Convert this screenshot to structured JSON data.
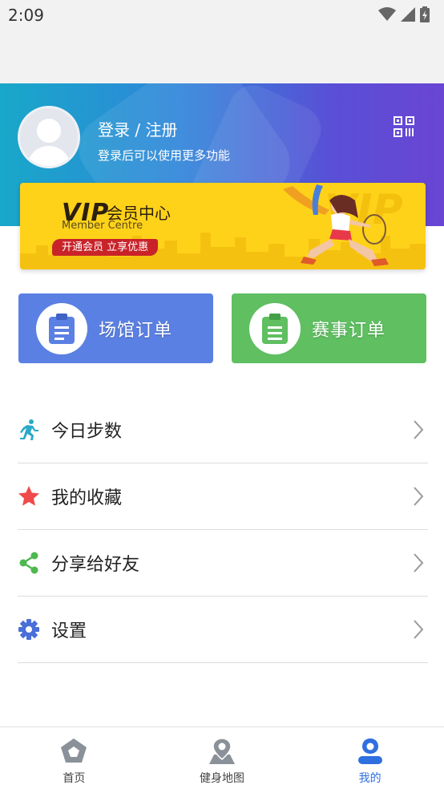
{
  "status_bar": {
    "time": "2:09"
  },
  "profile": {
    "login_title": "登录 / 注册",
    "login_subtitle": "登录后可以使用更多功能"
  },
  "vip": {
    "logo": "VIP",
    "title": "会员中心",
    "subtitle_en": "Member Centre",
    "badge": "开通会员 立享优惠",
    "bg_text": "VIP"
  },
  "orders": [
    {
      "label": "场馆订单",
      "color": "#5b80e3"
    },
    {
      "label": "赛事订单",
      "color": "#5fbf61"
    }
  ],
  "menu": [
    {
      "label": "今日步数",
      "icon": "running-icon",
      "color": "#2aa9c8"
    },
    {
      "label": "我的收藏",
      "icon": "star-icon",
      "color": "#f04a4a"
    },
    {
      "label": "分享给好友",
      "icon": "share-icon",
      "color": "#4cb84f"
    },
    {
      "label": "设置",
      "icon": "gear-icon",
      "color": "#4a6fd8"
    }
  ],
  "tabbar": [
    {
      "label": "首页",
      "icon": "home-pentagon-icon",
      "active": false
    },
    {
      "label": "健身地图",
      "icon": "map-pin-icon",
      "active": false
    },
    {
      "label": "我的",
      "icon": "user-icon",
      "active": true
    }
  ],
  "colors": {
    "accent": "#2f6fe0",
    "inactive_icon": "#8a9199"
  }
}
